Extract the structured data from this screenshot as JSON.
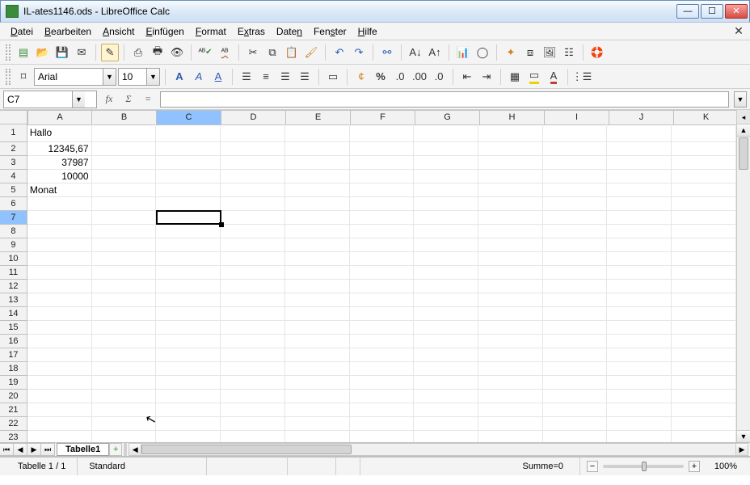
{
  "window": {
    "title": "IL-ates1146.ods - LibreOffice Calc"
  },
  "menu": {
    "items": [
      "Datei",
      "Bearbeiten",
      "Ansicht",
      "Einfügen",
      "Format",
      "Extras",
      "Daten",
      "Fenster",
      "Hilfe"
    ]
  },
  "format_bar": {
    "font_name": "Arial",
    "font_size": "10"
  },
  "cell_reference": "C7",
  "formula_value": "",
  "columns": [
    "A",
    "B",
    "C",
    "D",
    "E",
    "F",
    "G",
    "H",
    "I",
    "J",
    "K"
  ],
  "selected_col_index": 2,
  "selected_row_index": 6,
  "row_count": 23,
  "cells": {
    "A1": "Hallo",
    "A2": "12345,67",
    "A3": "37987",
    "A4": "10000",
    "A5": "Monat"
  },
  "numeric_rows": [
    2,
    3,
    4
  ],
  "sheet_tab": "Tabelle1",
  "status": {
    "sheet_pos": "Tabelle 1 / 1",
    "style": "Standard",
    "sum": "Summe=0",
    "zoom": "100%"
  }
}
